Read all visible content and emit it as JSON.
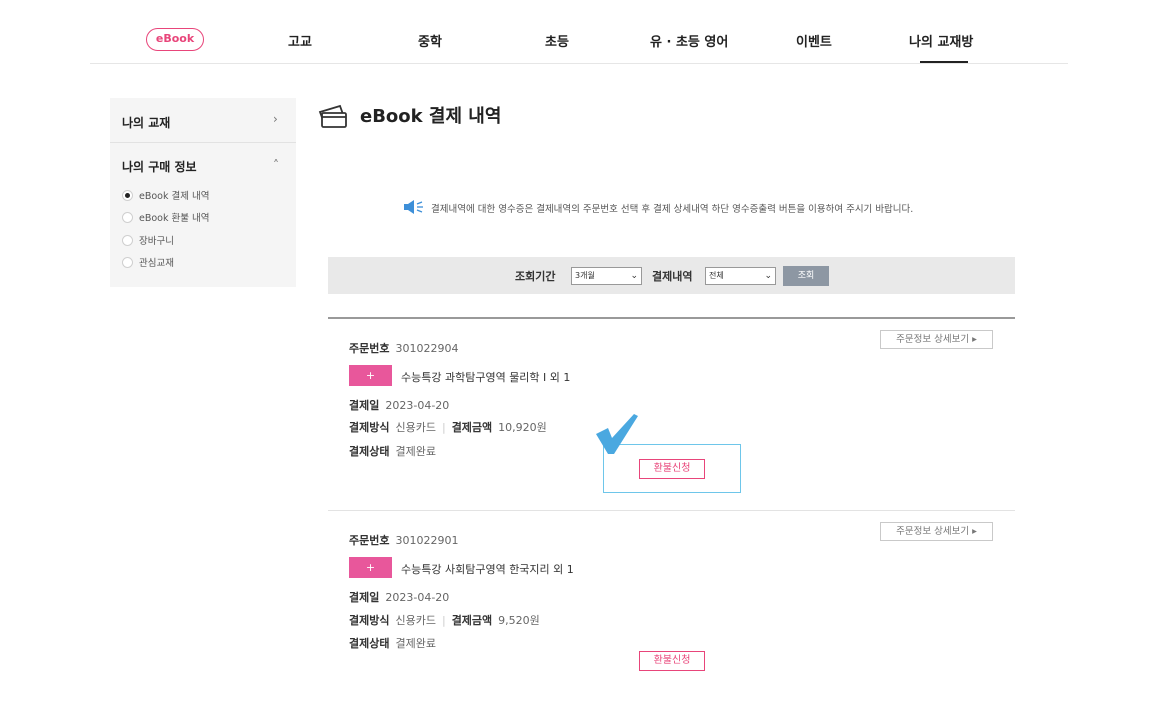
{
  "nav": {
    "ebook_label": "eBook",
    "items": [
      "고교",
      "중학",
      "초등",
      "유 · 초등 영어",
      "이벤트",
      "나의 교재방"
    ]
  },
  "sidebar": {
    "my_books": "나의 교재",
    "my_books_arrow": "›",
    "purchase_info": "나의 구매 정보",
    "purchase_arrow": "˄",
    "sub_items": [
      "eBook 결제 내역",
      "eBook 환불 내역",
      "장바구니",
      "관심교재"
    ],
    "selected_index": 0
  },
  "main": {
    "title": "eBook 결제 내역",
    "notice": "결제내역에 대한 영수증은 결제내역의 주문번호 선택 후 결제 상세내역 하단 영수증출력 버튼을 이용하여 주시기 바랍니다."
  },
  "filter": {
    "period_label": "조회기간",
    "period_value": "3개월",
    "status_label": "결제내역",
    "status_value": "전체",
    "search_button": "조회"
  },
  "orders": [
    {
      "order_label": "주문번호",
      "order_number": "301022904",
      "plus": "+",
      "product": "수능특강 과학탐구영역 물리학 I  외 1",
      "date_label": "결제일",
      "date": "2023-04-20",
      "method_label": "결제방식",
      "method": "신용카드",
      "amount_label": "결제금액",
      "amount": "10,920원",
      "status_label": "결제상태",
      "status": "결제완료",
      "detail_button": "주문정보 상세보기 ▸",
      "refund_button": "환불신청"
    },
    {
      "order_label": "주문번호",
      "order_number": "301022901",
      "plus": "+",
      "product": "수능특강 사회탐구영역 한국지리 외 1",
      "date_label": "결제일",
      "date": "2023-04-20",
      "method_label": "결제방식",
      "method": "신용카드",
      "amount_label": "결제금액",
      "amount": "9,520원",
      "status_label": "결제상태",
      "status": "결제완료",
      "detail_button": "주문정보 상세보기 ▸",
      "refund_button": "환불신청"
    }
  ],
  "colors": {
    "accent_pink": "#e8457a",
    "plus_button": "#e8579b",
    "search_button": "#8d97a3",
    "highlight": "#6ec6ea",
    "checkmark": "#4aa8e0"
  }
}
